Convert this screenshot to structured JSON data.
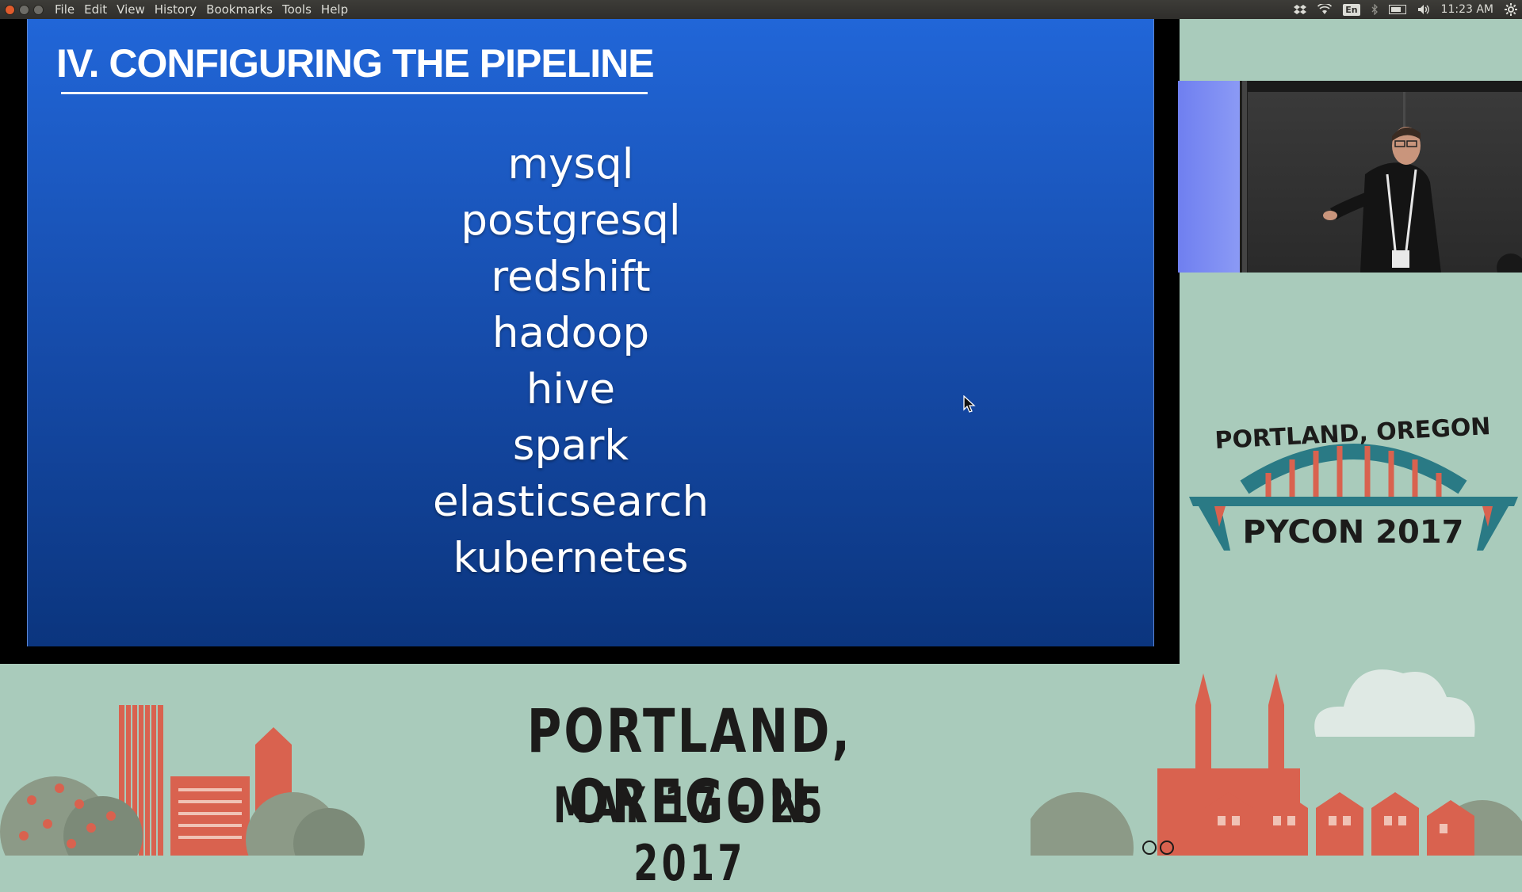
{
  "window": {
    "menu": [
      "File",
      "Edit",
      "View",
      "History",
      "Bookmarks",
      "Tools",
      "Help"
    ]
  },
  "tray": {
    "language": "En",
    "clock": "11:23 AM",
    "icons": [
      "dropbox-icon",
      "wifi-icon",
      "keyboard-language-icon",
      "bluetooth-icon",
      "battery-icon",
      "volume-icon",
      "settings-gear-icon"
    ]
  },
  "slide": {
    "title": "IV.  CONFIGURING THE PIPELINE",
    "items": [
      "mysql",
      "postgresql",
      "redshift",
      "hadoop",
      "hive",
      "spark",
      "elasticsearch",
      "kubernetes"
    ],
    "background_top": "#2166d8",
    "background_bottom": "#0b357e"
  },
  "conference": {
    "logo_city": "PORTLAND, OREGON",
    "logo_name": "PYCON 2017",
    "banner_city": "PORTLAND, OREGON",
    "banner_dates": "MAY 17 - 25 2017",
    "background": "#a9cbbb",
    "accent_red": "#d9624f",
    "accent_teal": "#2a7a85"
  }
}
